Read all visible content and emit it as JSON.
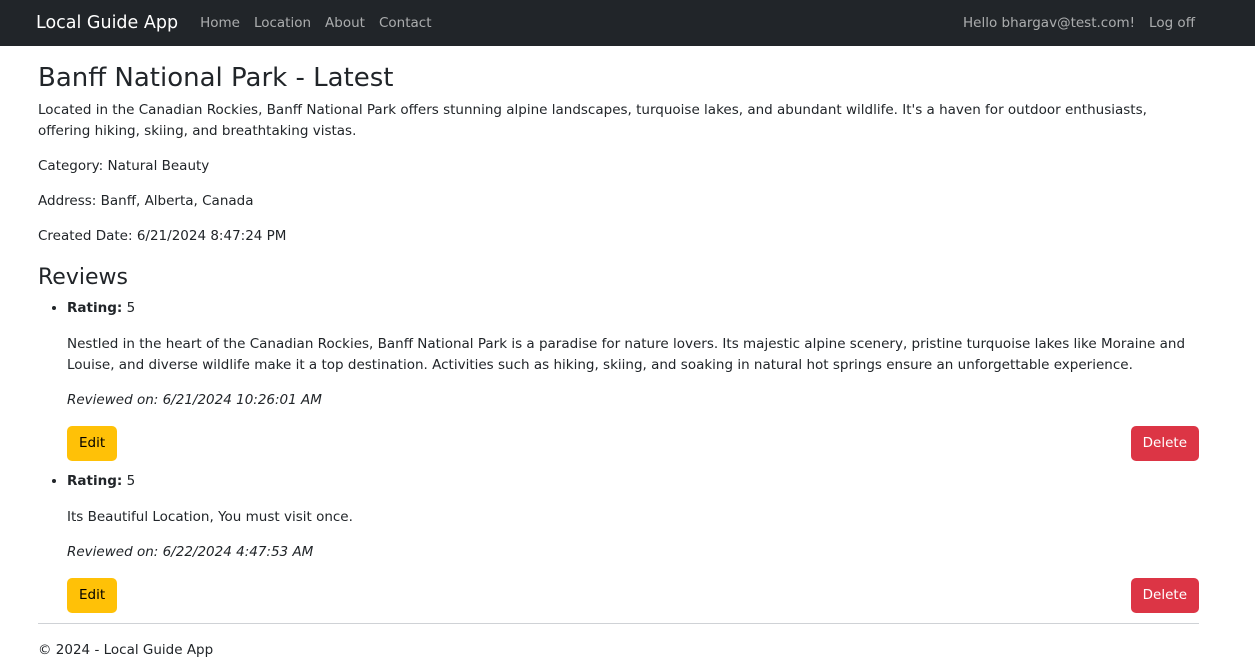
{
  "nav": {
    "brand": "Local Guide App",
    "links": [
      "Home",
      "Location",
      "About",
      "Contact"
    ],
    "greeting": "Hello bhargav@test.com!",
    "logoff": "Log off"
  },
  "place": {
    "title": "Banff National Park - Latest",
    "description": "Located in the Canadian Rockies, Banff National Park offers stunning alpine landscapes, turquoise lakes, and abundant wildlife. It's a haven for outdoor enthusiasts, offering hiking, skiing, and breathtaking vistas.",
    "category": "Category: Natural Beauty",
    "address": "Address: Banff, Alberta, Canada",
    "created": "Created Date: 6/21/2024 8:47:24 PM"
  },
  "reviews": {
    "heading": "Reviews",
    "rating_label": "Rating:",
    "edit_label": "Edit",
    "delete_label": "Delete",
    "items": [
      {
        "rating": "5",
        "text": "Nestled in the heart of the Canadian Rockies, Banff National Park is a paradise for nature lovers. Its majestic alpine scenery, pristine turquoise lakes like Moraine and Louise, and diverse wildlife make it a top destination. Activities such as hiking, skiing, and soaking in natural hot springs ensure an unforgettable experience.",
        "reviewed_on": "Reviewed on: 6/21/2024 10:26:01 AM"
      },
      {
        "rating": "5",
        "text": "Its Beautiful Location, You must visit once.",
        "reviewed_on": "Reviewed on: 6/22/2024 4:47:53 AM"
      }
    ]
  },
  "footer": {
    "text": "© 2024 - Local Guide App"
  },
  "colors": {
    "navbar": "#212529",
    "edit_button": "#ffc107",
    "delete_button": "#dc3545"
  }
}
